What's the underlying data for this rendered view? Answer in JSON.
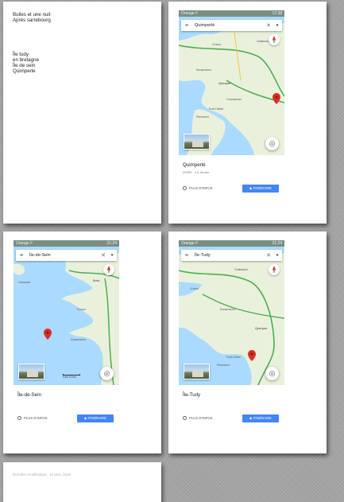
{
  "pages": {
    "note": {
      "lines_a": [
        "Bulles et une nuit",
        "Après sarrebourg"
      ],
      "lines_b": [
        "Île tudy",
        "en bretagne",
        "Île de sein",
        "Quimperle"
      ]
    },
    "card_quimperle": {
      "status_left": "Orange F",
      "status_right": "17:38",
      "search_value": "Quimperlé",
      "place_name": "Quimperlé",
      "subtitle": "29300 · 4 h 48 min",
      "more_info": "PLUS D'INFOS",
      "route_label": "ITINÉRAIRE",
      "map_labels": [
        "Concarneau",
        "Quimper",
        "Châteaulin",
        "Crozon",
        "Douarnenez",
        "Pont-l'Abbé",
        "Penmarch"
      ]
    },
    "card_sein": {
      "status_left": "Orange F",
      "status_right": "21:24",
      "search_value": "Île-de-Sein",
      "place_name": "Île-de-Sein",
      "more_info": "PLUS D'INFOS",
      "route_label": "ITINÉRAIRE",
      "map_labels": [
        "Ouessant",
        "Brest",
        "Crozon",
        "Douarnenez"
      ],
      "scale_labels": [
        "5 km",
        "10 km"
      ]
    },
    "card_tudy": {
      "status_left": "Orange F",
      "status_right": "21:24",
      "search_value": "Île-Tudy",
      "place_name": "Île-Tudy",
      "more_info": "PLUS D'INFOS",
      "route_label": "ITINÉRAIRE",
      "map_labels": [
        "Châteaulin",
        "Crozon",
        "Douarnenez",
        "Quimper",
        "Pont-l'Abbé",
        "Penmarch"
      ]
    },
    "footer": {
      "text": "Dernière modification : 13 janv. 2016"
    }
  },
  "icons": {
    "menu": "≡",
    "clear": "✕",
    "mic": "🎤",
    "locate": "◎",
    "route": "◆"
  },
  "colors": {
    "accent": "#4285f4",
    "pin": "#d93025",
    "sea": "#aadaff",
    "land": "#e9f1dd",
    "road": "#4caf50"
  }
}
